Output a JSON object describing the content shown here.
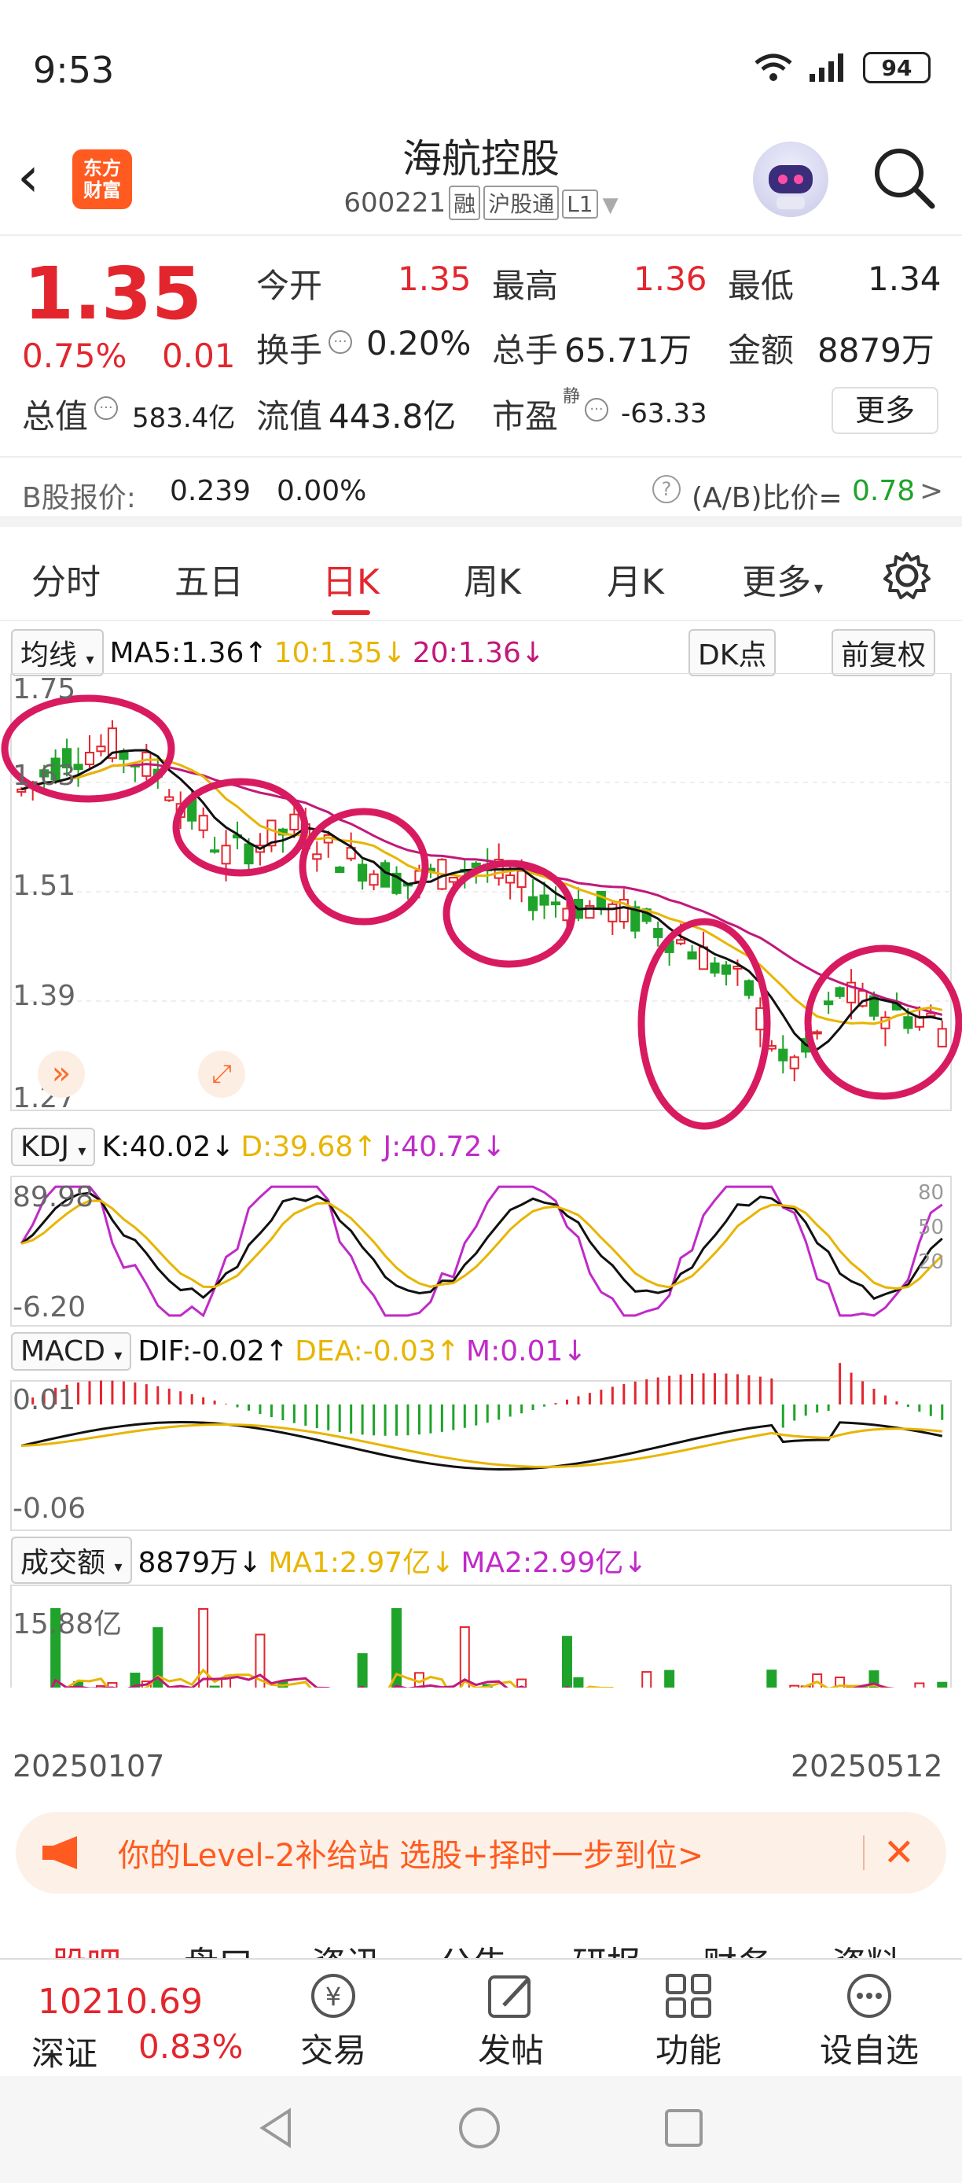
{
  "status": {
    "time": "9:53",
    "battery": "94"
  },
  "header": {
    "title": "海航控股",
    "code": "600221",
    "tags": [
      "融",
      "沪股通",
      "L1"
    ],
    "logo_line1": "东方",
    "logo_line2": "财富"
  },
  "quote": {
    "price": "1.35",
    "change_pct": "0.75%",
    "change": "0.01",
    "open_label": "今开",
    "open": "1.35",
    "high_label": "最高",
    "high": "1.36",
    "low_label": "最低",
    "low": "1.34",
    "turnover_label": "换手",
    "turnover": "0.20%",
    "volume_label": "总手",
    "volume": "65.71万",
    "amount_label": "金额",
    "amount": "8879万",
    "mktcap_label": "总值",
    "mktcap": "583.4亿",
    "float_label": "流值",
    "float": "443.8亿",
    "pe_label": "市盈",
    "pe_sup": "静",
    "pe": "-63.33",
    "more": "更多"
  },
  "bshare": {
    "label": "B股报价:",
    "price": "0.239",
    "pct": "0.00%",
    "ratio_label": "(A/B)比价=",
    "ratio": "0.78",
    "arrow": ">"
  },
  "tabs": [
    "分时",
    "五日",
    "日K",
    "周K",
    "月K",
    "更多"
  ],
  "active_tab": "日K",
  "chart": {
    "ma_selector": "均线",
    "ma5": "MA5:1.36↑",
    "ma10": "10:1.35↓",
    "ma20": "20:1.36↓",
    "dk": "DK点",
    "adjust": "前复权",
    "price_ticks": [
      "1.75",
      "1.63",
      "1.51",
      "1.39",
      "1.27"
    ],
    "kdj_selector": "KDJ",
    "kdj_k": "K:40.02↓",
    "kdj_d": "D:39.68↑",
    "kdj_j": "J:40.72↓",
    "kdj_top": "89.98",
    "kdj_bottom": "-6.20",
    "kdj_levels": [
      "80",
      "50",
      "20"
    ],
    "macd_selector": "MACD",
    "macd_dif": "DIF:-0.02↑",
    "macd_dea": "DEA:-0.03↑",
    "macd_m": "M:0.01↓",
    "macd_top": "0.01",
    "macd_bottom": "-0.06",
    "vol_selector": "成交额",
    "vol_value": "8879万↓",
    "vol_ma1": "MA1:2.97亿↓",
    "vol_ma2": "MA2:2.99亿↓",
    "vol_top": "15.88亿",
    "date_start": "20250107",
    "date_end": "20250512"
  },
  "chart_data": {
    "type": "candlestick",
    "x_start": "20250107",
    "x_end": "20250512",
    "ylim": [
      1.27,
      1.75
    ],
    "last_close": 1.35
  },
  "banner": {
    "text": "你的Level-2补给站 选股+择时一步到位>"
  },
  "subtabs": [
    "股吧",
    "盘口",
    "资讯",
    "公告",
    "研报",
    "财务",
    "资料"
  ],
  "bottom": {
    "index_value": "10210.69",
    "index_name": "深证",
    "index_pct": "0.83%",
    "trade": "交易",
    "post": "发帖",
    "func": "功能",
    "watch": "设自选"
  },
  "colors": {
    "up": "#e3262e",
    "down": "#1fa32a",
    "ma5": "#111111",
    "ma10": "#e8b500",
    "ma20": "#c2187a",
    "circle": "#d81b60"
  }
}
